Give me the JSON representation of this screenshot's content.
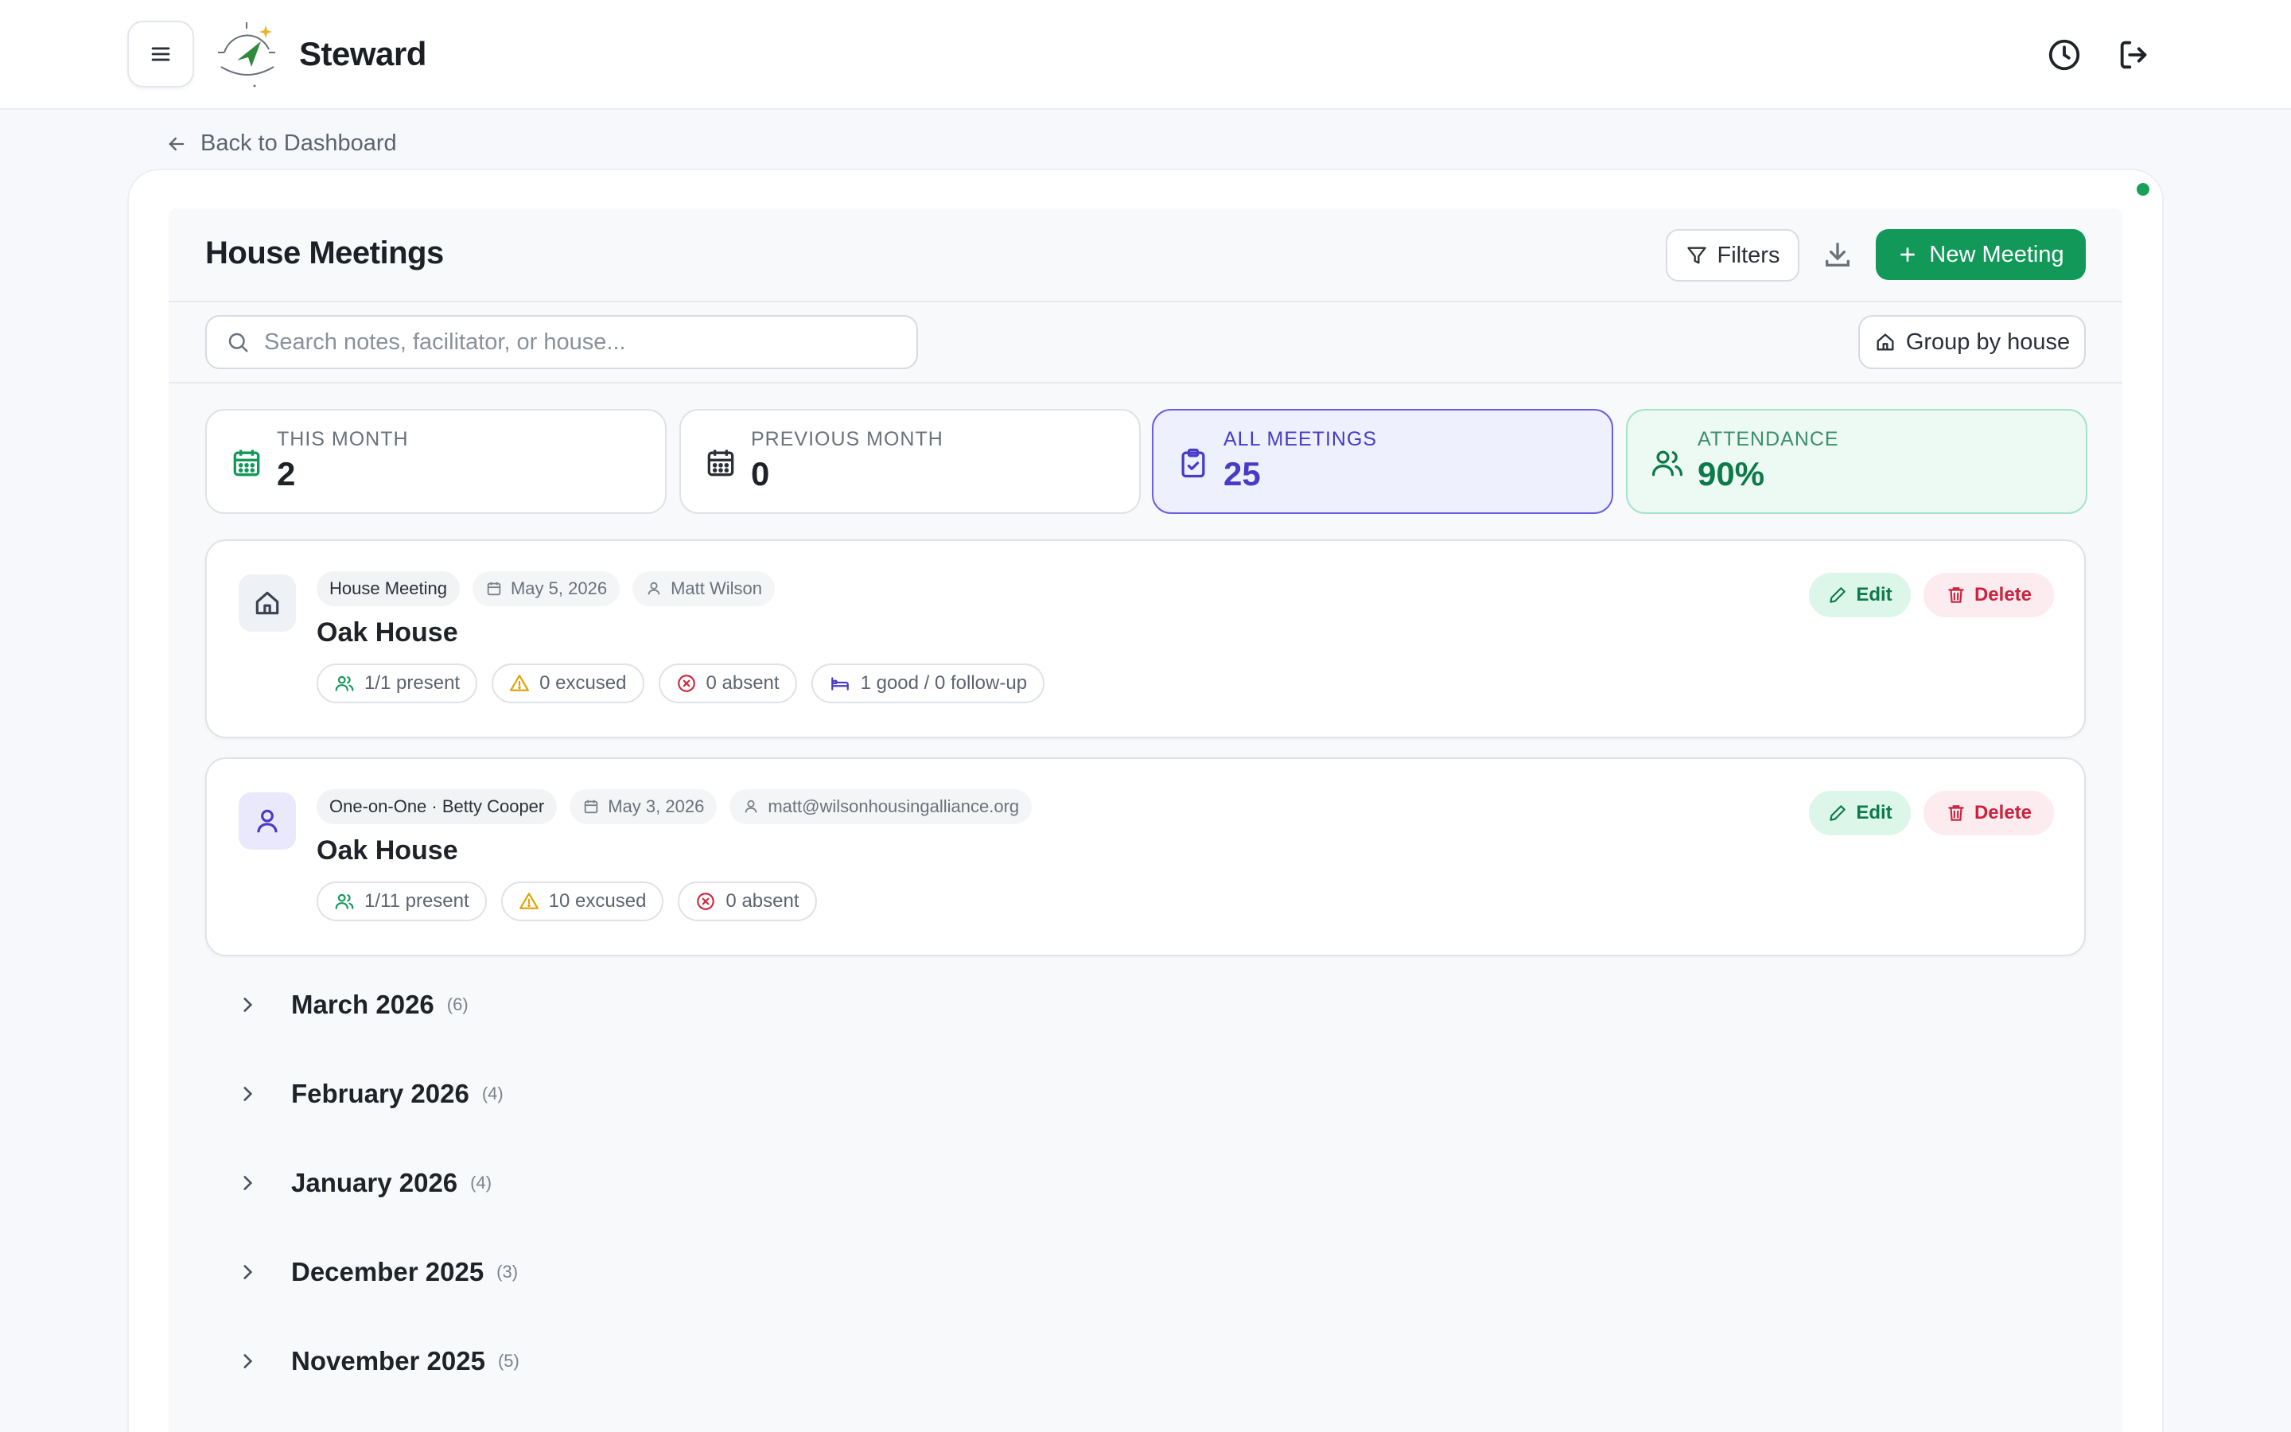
{
  "app": {
    "name": "Steward"
  },
  "nav": {
    "back_label": "Back to Dashboard"
  },
  "page": {
    "title": "House Meetings"
  },
  "toolbar": {
    "filters_label": "Filters",
    "new_meeting_label": "New Meeting",
    "group_by_label": "Group by house"
  },
  "search": {
    "placeholder": "Search notes, facilitator, or house..."
  },
  "stats": [
    {
      "label": "THIS MONTH",
      "value": "2",
      "icon": "calendar-icon"
    },
    {
      "label": "PREVIOUS MONTH",
      "value": "0",
      "icon": "calendar-icon"
    },
    {
      "label": "ALL MEETINGS",
      "value": "25",
      "icon": "clipboard-check-icon"
    },
    {
      "label": "ATTENDANCE",
      "value": "90%",
      "icon": "users-icon"
    }
  ],
  "meetings": [
    {
      "type": "House Meeting",
      "date": "May 5, 2026",
      "facilitator": "Matt Wilson",
      "house": "Oak House",
      "present": "1/1 present",
      "excused": "0 excused",
      "absent": "0 absent",
      "beds": "1 good / 0 follow-up",
      "edit_label": "Edit",
      "delete_label": "Delete"
    },
    {
      "type": "One-on-One · Betty Cooper",
      "date": "May 3, 2026",
      "facilitator": "matt@wilsonhousingalliance.org",
      "house": "Oak House",
      "present": "1/11 present",
      "excused": "10 excused",
      "absent": "0 absent",
      "edit_label": "Edit",
      "delete_label": "Delete"
    }
  ],
  "month_groups": [
    {
      "name": "March 2026",
      "count": "(6)"
    },
    {
      "name": "February 2026",
      "count": "(4)"
    },
    {
      "name": "January 2026",
      "count": "(4)"
    },
    {
      "name": "December 2025",
      "count": "(3)"
    },
    {
      "name": "November 2025",
      "count": "(5)"
    }
  ],
  "colors": {
    "primary": "#12995a",
    "danger": "#c8243f",
    "accent_indigo": "#4a3bc6",
    "warning": "#e0a100"
  }
}
